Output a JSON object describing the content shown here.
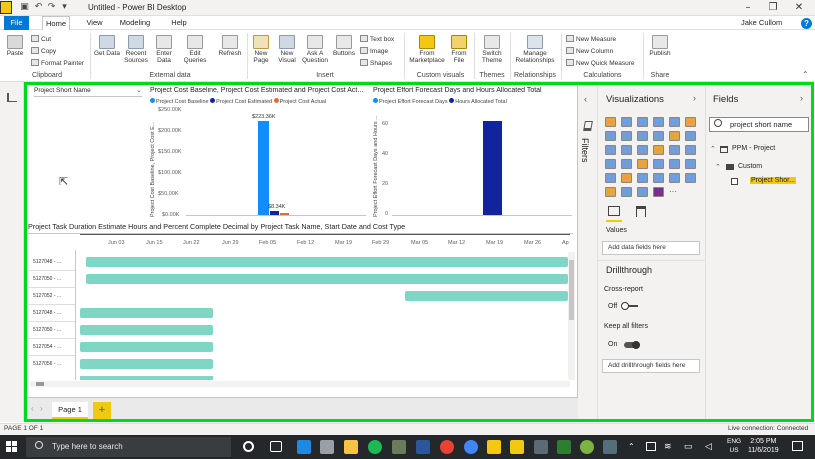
{
  "window": {
    "title": "Untitled - Power BI Desktop",
    "minimize": "–",
    "restore": "❐",
    "close": "✕"
  },
  "menu": {
    "tabs": [
      "File",
      "Home",
      "View",
      "Modeling",
      "Help"
    ],
    "user": "Jake Cullom",
    "help": "?"
  },
  "ribbon": {
    "paste": "Paste",
    "cut": "Cut",
    "copy": "Copy",
    "format_painter": "Format Painter",
    "get_data": "Get Data",
    "recent_sources": "Recent Sources",
    "enter_data": "Enter Data",
    "edit_queries": "Edit Queries",
    "refresh": "Refresh",
    "new_page": "New Page",
    "new_visual": "New Visual",
    "ask_question": "Ask A Question",
    "buttons": "Buttons",
    "text_box": "Text box",
    "image": "Image",
    "shapes": "Shapes",
    "from_marketplace": "From Marketplace",
    "from_file": "From File",
    "switch_theme": "Switch Theme",
    "manage_relationships": "Manage Relationships",
    "new_measure": "New Measure",
    "new_column": "New Column",
    "new_quick_measure": "New Quick Measure",
    "publish": "Publish",
    "groups": {
      "clipboard": "Clipboard",
      "external_data": "External data",
      "insert": "Insert",
      "custom_visuals": "Custom visuals",
      "themes": "Themes",
      "relationships": "Relationships",
      "calculations": "Calculations",
      "share": "Share"
    }
  },
  "slicer": {
    "title": "Project Short Name"
  },
  "cost_chart": {
    "title": "Project Cost Baseline, Project Cost Estimated and Project Cost Act...",
    "legend": [
      "Project Cost Baseline",
      "Project Cost Estimated",
      "Project Cost Actual"
    ],
    "y_label": "Project Cost Baseline, Project Cost E...",
    "ticks": [
      "$250.00K",
      "$200.00K",
      "$150.00K",
      "$100.00K",
      "$50.00K",
      "$0.00K"
    ],
    "data_labels": [
      "$223.36K",
      "$8.34K"
    ]
  },
  "effort_chart": {
    "title": "Project Effort Forecast Days and Hours Allocated Total",
    "legend": [
      "Project Effort Forecast Days",
      "Hours Allocated Total"
    ],
    "y_label": "Project Effort Forecast Days and Hours ...",
    "ticks": [
      "60",
      "40",
      "20",
      "0"
    ]
  },
  "gantt": {
    "title": "Project Task Duration Estimate Hours and Percent Complete Decimal by Project Task Name, Start Date and Cost Type",
    "dates": [
      "Jun 03",
      "Jun 15",
      "Jun 22",
      "Jun 29",
      "Feb 05",
      "Feb 12",
      "Mar 19",
      "Feb 29",
      "Mar 05",
      "Mar 12",
      "Mar 19",
      "Mar 26",
      "Ap"
    ],
    "rows": [
      "5127048 - ...",
      "5127050 - ...",
      "5127052 - ...",
      "5127048 - ...",
      "5127050 - ...",
      "5127054 - ...",
      "5127056 - ..."
    ]
  },
  "filters": {
    "label": "Filters"
  },
  "visualizations": {
    "title": "Visualizations",
    "values_label": "Values",
    "add_data": "Add data fields here",
    "drillthrough_title": "Drillthrough",
    "cross_report": "Cross-report",
    "off": "Off",
    "keep_filters": "Keep all filters",
    "on": "On",
    "add_drillthrough": "Add drillthrough fields here"
  },
  "fields": {
    "title": "Fields",
    "search_value": "project short name",
    "table": "PPM - Project",
    "folder": "Custom",
    "field": "Project Shor..."
  },
  "pages": {
    "page1": "Page 1",
    "add": "+"
  },
  "status": {
    "page": "PAGE 1 OF 1",
    "connection": "Live connection: Connected"
  },
  "taskbar": {
    "search": "Type here to search",
    "time": "2:05 PM",
    "date": "11/6/2019",
    "lang1": "ENG",
    "lang2": "US"
  },
  "colors": {
    "accent_blue": "#118dff",
    "navy": "#12239e",
    "orange": "#e66c37",
    "teal": "#7fd6c5",
    "highlight": "#00d91a",
    "brand_yellow": "#f2c811"
  }
}
